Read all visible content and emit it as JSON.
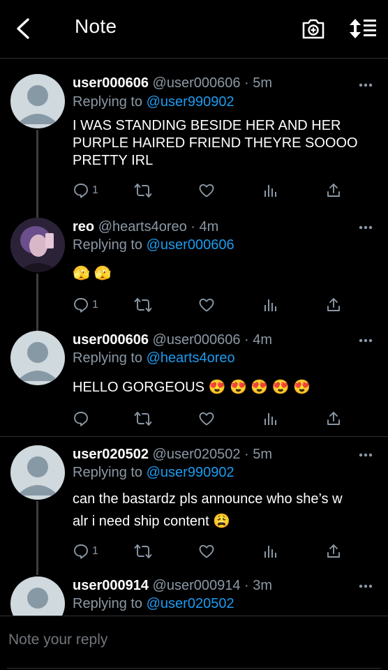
{
  "header": {
    "title": "Note"
  },
  "tweets": [
    {
      "name": "user000606",
      "handle": "@user000606 · 5m",
      "replying_label": "Replying to",
      "replying_to": "@user990902",
      "text": "I WAS STANDING BESIDE HER AND HER PURPLE HAIRED FRIEND THEYRE SOOOO PRETTY IRL",
      "reply_count": "1"
    },
    {
      "name": "reo",
      "handle": "@hearts4oreo · 4m",
      "replying_label": "Replying to",
      "replying_to": "@user000606",
      "text": "🫣 🫣",
      "reply_count": "1"
    },
    {
      "name": "user000606",
      "handle": "@user000606 · 4m",
      "replying_label": "Replying to",
      "replying_to": "@hearts4oreo",
      "text": "HELLO GORGEOUS 😍 😍 😍 😍 😍",
      "reply_count": ""
    },
    {
      "name": "user020502",
      "handle": "@user020502 · 5m",
      "replying_label": "Replying to",
      "replying_to": "@user990902",
      "text_line1": "can the bastardz pls announce who she’s w",
      "text_line2": "alr i need ship content 😩",
      "reply_count": "1"
    },
    {
      "name": "user000914",
      "handle": "@user000914 · 3m",
      "replying_label": "Replying to",
      "replying_to": "@user020502"
    }
  ],
  "composer": {
    "placeholder": "Note your reply"
  },
  "colors": {
    "link": "#1d9bf0",
    "muted": "#8b98a5",
    "divider": "#2f3336",
    "avatar": "#cfd9de"
  }
}
